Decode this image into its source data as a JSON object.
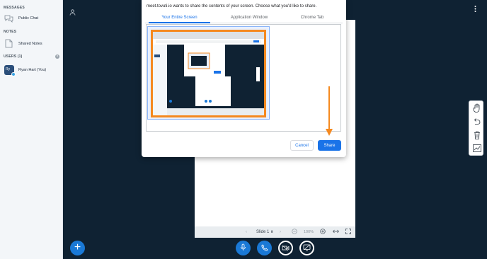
{
  "sidebar": {
    "messages_title": "MESSAGES",
    "public_chat": "Public Chat",
    "notes_title": "NOTES",
    "shared_notes": "Shared Notes",
    "users_title": "USERS (1)",
    "user": {
      "initials": "Ry",
      "name": "Ryan Hart (You)"
    }
  },
  "dialog": {
    "title": "meet.tovuti.io wants to share the contents of your screen. Choose what you'd like to share.",
    "tabs": [
      {
        "label": "Your Entire Screen",
        "active": true
      },
      {
        "label": "Application Window",
        "active": false
      },
      {
        "label": "Chrome Tab",
        "active": false
      }
    ],
    "cancel_label": "Cancel",
    "share_label": "Share"
  },
  "slide_controls": {
    "slide_label": "Slide 1",
    "zoom": "100%"
  },
  "colors": {
    "accent_blue": "#1a73e8",
    "highlight_orange": "#f5891f",
    "background": "#0f2233",
    "control_blue": "#1a79d6"
  },
  "icons": {
    "chat": "chat-bubbles-icon",
    "notes": "document-icon",
    "user": "user-icon",
    "menu": "vertical-dots-icon",
    "hand": "hand-icon",
    "undo": "undo-icon",
    "trash": "trash-icon",
    "chart": "chart-icon",
    "mic": "microphone-icon",
    "phone": "phone-icon",
    "video": "video-off-icon",
    "screen": "screen-share-off-icon"
  }
}
